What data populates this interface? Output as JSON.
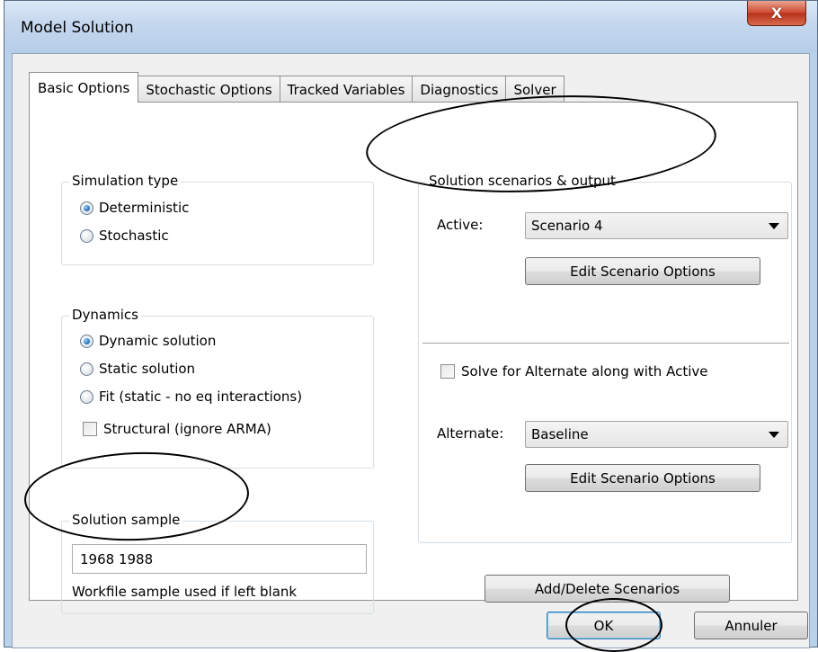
{
  "window": {
    "title": "Model Solution",
    "close_glyph": "X"
  },
  "tabs": [
    {
      "label": "Basic Options",
      "active": true
    },
    {
      "label": "Stochastic Options"
    },
    {
      "label": "Tracked Variables"
    },
    {
      "label": "Diagnostics"
    },
    {
      "label": "Solver"
    }
  ],
  "simulation_type": {
    "title": "Simulation type",
    "options": [
      {
        "label": "Deterministic",
        "selected": true
      },
      {
        "label": "Stochastic",
        "selected": false
      }
    ]
  },
  "dynamics": {
    "title": "Dynamics",
    "options": [
      {
        "label": "Dynamic solution",
        "selected": true
      },
      {
        "label": "Static solution",
        "selected": false
      },
      {
        "label": "Fit (static - no eq interactions)",
        "selected": false
      }
    ],
    "structural": {
      "label": "Structural (ignore ARMA)",
      "checked": false
    }
  },
  "solution_sample": {
    "title": "Solution sample",
    "value": "1968 1988",
    "hint": "Workfile sample used if left blank"
  },
  "scenarios": {
    "title": "Solution scenarios & output",
    "active_label": "Active:",
    "active_value": "Scenario 4",
    "edit_button": "Edit Scenario Options",
    "solve_alternate": {
      "label": "Solve for Alternate along with Active",
      "checked": false
    },
    "alternate_label": "Alternate:",
    "alternate_value": "Baseline",
    "edit_button_2": "Edit Scenario Options",
    "add_delete_button": "Add/Delete Scenarios"
  },
  "footer": {
    "ok": "OK",
    "cancel": "Annuler"
  },
  "colors": {
    "accent": "#3c7fb1",
    "close": "#c7432a",
    "frame": "#b9d1ea"
  }
}
